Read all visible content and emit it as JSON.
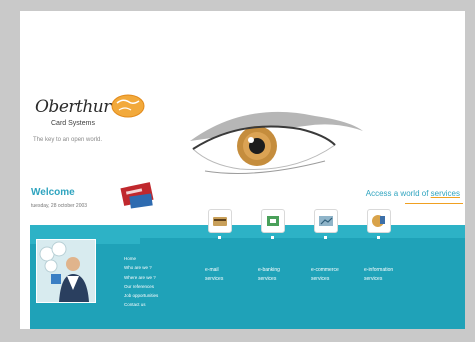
{
  "site": {
    "brand": "Oberthur",
    "brand_sub": "Card Systems",
    "tagline": "The key to an open world."
  },
  "welcome": {
    "title": "Welcome",
    "date": "tuesday, 28 october 2003"
  },
  "access": {
    "prefix": "Access a world of ",
    "emphasis": "services"
  },
  "menu": {
    "items": [
      "Home",
      "Who are we ?",
      "Where are we ?",
      "Our references",
      "Job opportunities",
      "Contact us"
    ]
  },
  "services": [
    {
      "line1": "e-mail",
      "line2": "services",
      "icon": "email-card-icon"
    },
    {
      "line1": "e-banking",
      "line2": "services",
      "icon": "banking-card-icon"
    },
    {
      "line1": "e-commerce",
      "line2": "services",
      "icon": "commerce-card-icon"
    },
    {
      "line1": "e-information",
      "line2": "services",
      "icon": "information-card-icon"
    }
  ],
  "colors": {
    "teal": "#1fa2b8",
    "teal_light": "#2db2c6",
    "accent_orange": "#f0a021",
    "brand_blue": "#2fa4bf"
  }
}
